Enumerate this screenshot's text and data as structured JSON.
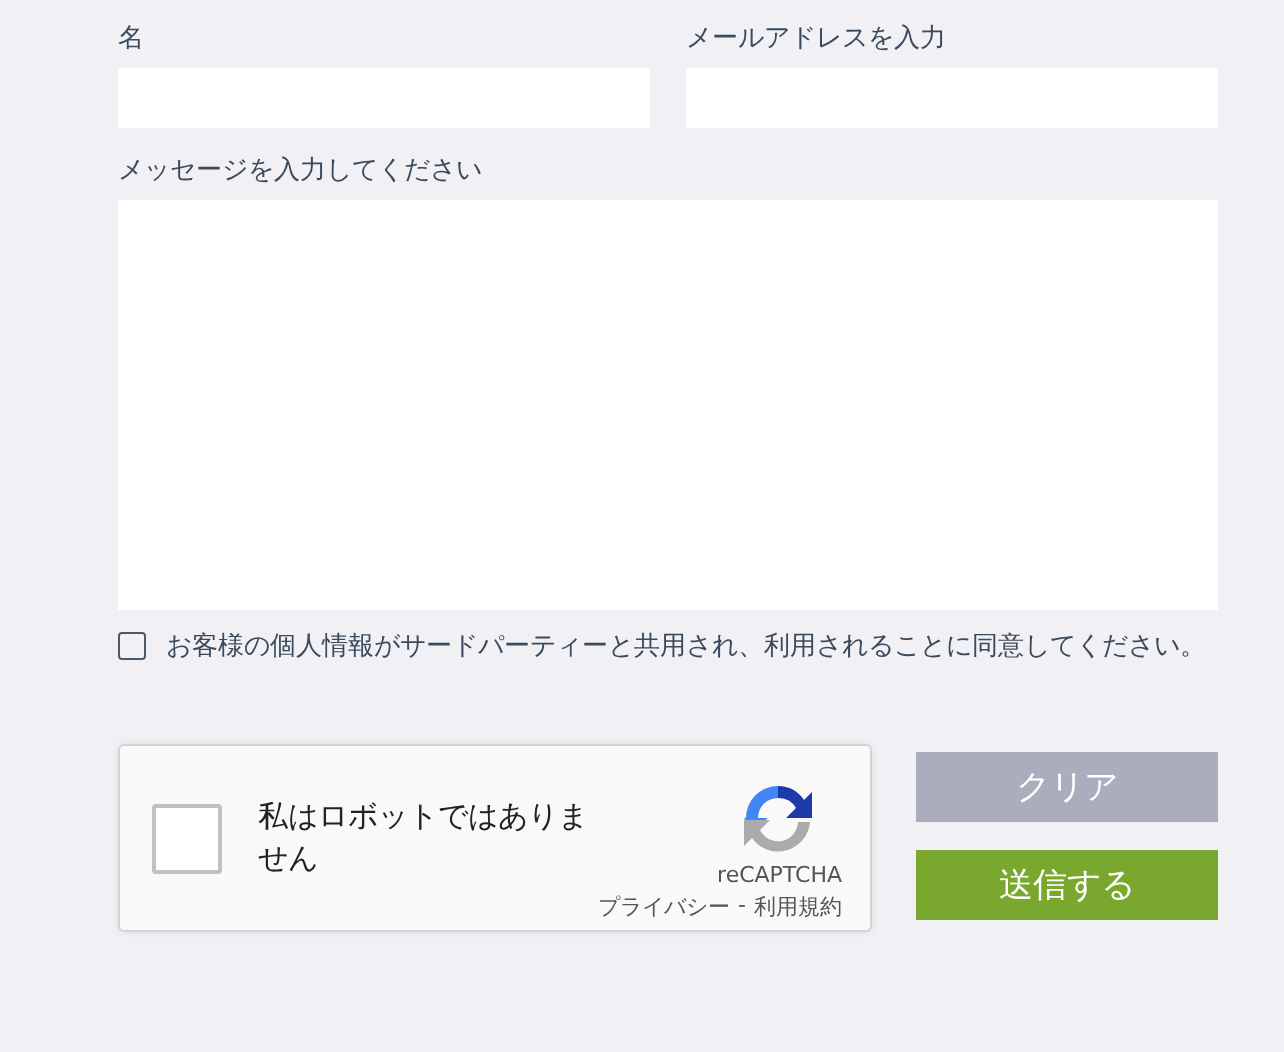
{
  "fields": [
    {
      "kind": "input",
      "label": "名"
    },
    {
      "kind": "input",
      "label": "メールアドレスを入力"
    },
    {
      "kind": "textarea",
      "label": "メッセージを入力してください"
    }
  ],
  "consent": {
    "checked": false,
    "text": "お客様の個人情報がサードパーティーと共用され、利用されることに同意してください。"
  },
  "recaptcha": {
    "checked": false,
    "label": "私はロボットではありません",
    "brand": "reCAPTCHA",
    "privacy": "プライバシー",
    "separator": "-",
    "terms": "利用規約"
  },
  "buttons": [
    {
      "label": "クリア",
      "disabled": true
    },
    {
      "label": "送信する",
      "disabled": false
    }
  ]
}
